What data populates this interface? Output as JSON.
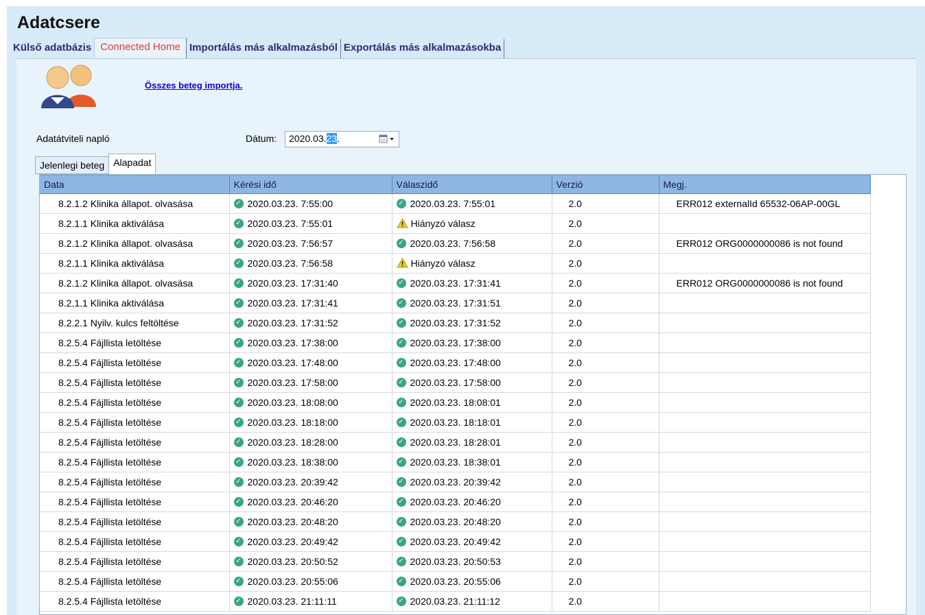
{
  "app": {
    "title": "Adatcsere"
  },
  "main_tabs": [
    {
      "label": "Külső adatbázis",
      "active": false
    },
    {
      "label": "Connected Home",
      "active": true
    },
    {
      "label": "Importálás más alkalmazásból",
      "active": false
    },
    {
      "label": "Exportálás más alkalmazásokba",
      "active": false
    }
  ],
  "import_link": "Összes beteg importja.",
  "log_label": "Adatátviteli napló",
  "date": {
    "label": "Dátum:",
    "value_prefix": "2020.03.",
    "value_selected": "23",
    "value_suffix": "."
  },
  "sub_tabs": [
    {
      "label": "Jelenlegi beteg",
      "active": false
    },
    {
      "label": "Alapadat",
      "active": true
    }
  ],
  "colors": {
    "ok": "#3aa582",
    "warn": "#f2d21b",
    "header": "#8db6e4",
    "active_tab": "#e23838",
    "link": "#0b00d6"
  },
  "table": {
    "columns": [
      "Data",
      "Kérési idő",
      "Válaszidő",
      "Verzió",
      "Megj."
    ],
    "rows": [
      {
        "data": "8.2.1.2 Klinika állapot. olvasása",
        "req": "2020.03.23. 7:55:00",
        "resp": "2020.03.23. 7:55:01",
        "resp_status": "ok",
        "ver": "2.0",
        "note": "ERR012 externalId 65532-06AP-00GL"
      },
      {
        "data": "8.2.1.1 Klinika aktiválása",
        "req": "2020.03.23. 7:55:01",
        "resp": "Hiányzó válasz",
        "resp_status": "warn",
        "ver": "2.0",
        "note": ""
      },
      {
        "data": "8.2.1.2 Klinika állapot. olvasása",
        "req": "2020.03.23. 7:56:57",
        "resp": "2020.03.23. 7:56:58",
        "resp_status": "ok",
        "ver": "2.0",
        "note": "ERR012 ORG0000000086 is not found"
      },
      {
        "data": "8.2.1.1 Klinika aktiválása",
        "req": "2020.03.23. 7:56:58",
        "resp": "Hiányzó válasz",
        "resp_status": "warn",
        "ver": "2.0",
        "note": ""
      },
      {
        "data": "8.2.1.2 Klinika állapot. olvasása",
        "req": "2020.03.23. 17:31:40",
        "resp": "2020.03.23. 17:31:41",
        "resp_status": "ok",
        "ver": "2.0",
        "note": "ERR012 ORG0000000086 is not found"
      },
      {
        "data": "8.2.1.1 Klinika aktiválása",
        "req": "2020.03.23. 17:31:41",
        "resp": "2020.03.23. 17:31:51",
        "resp_status": "ok",
        "ver": "2.0",
        "note": ""
      },
      {
        "data": "8.2.2.1 Nyilv. kulcs feltöltése",
        "req": "2020.03.23. 17:31:52",
        "resp": "2020.03.23. 17:31:52",
        "resp_status": "ok",
        "ver": "2.0",
        "note": ""
      },
      {
        "data": "8.2.5.4 Fájllista letöltése",
        "req": "2020.03.23. 17:38:00",
        "resp": "2020.03.23. 17:38:00",
        "resp_status": "ok",
        "ver": "2.0",
        "note": ""
      },
      {
        "data": "8.2.5.4 Fájllista letöltése",
        "req": "2020.03.23. 17:48:00",
        "resp": "2020.03.23. 17:48:00",
        "resp_status": "ok",
        "ver": "2.0",
        "note": ""
      },
      {
        "data": "8.2.5.4 Fájllista letöltése",
        "req": "2020.03.23. 17:58:00",
        "resp": "2020.03.23. 17:58:00",
        "resp_status": "ok",
        "ver": "2.0",
        "note": ""
      },
      {
        "data": "8.2.5.4 Fájllista letöltése",
        "req": "2020.03.23. 18:08:00",
        "resp": "2020.03.23. 18:08:01",
        "resp_status": "ok",
        "ver": "2.0",
        "note": ""
      },
      {
        "data": "8.2.5.4 Fájllista letöltése",
        "req": "2020.03.23. 18:18:00",
        "resp": "2020.03.23. 18:18:01",
        "resp_status": "ok",
        "ver": "2.0",
        "note": ""
      },
      {
        "data": "8.2.5.4 Fájllista letöltése",
        "req": "2020.03.23. 18:28:00",
        "resp": "2020.03.23. 18:28:01",
        "resp_status": "ok",
        "ver": "2.0",
        "note": ""
      },
      {
        "data": "8.2.5.4 Fájllista letöltése",
        "req": "2020.03.23. 18:38:00",
        "resp": "2020.03.23. 18:38:01",
        "resp_status": "ok",
        "ver": "2.0",
        "note": ""
      },
      {
        "data": "8.2.5.4 Fájllista letöltése",
        "req": "2020.03.23. 20:39:42",
        "resp": "2020.03.23. 20:39:42",
        "resp_status": "ok",
        "ver": "2.0",
        "note": ""
      },
      {
        "data": "8.2.5.4 Fájllista letöltése",
        "req": "2020.03.23. 20:46:20",
        "resp": "2020.03.23. 20:46:20",
        "resp_status": "ok",
        "ver": "2.0",
        "note": ""
      },
      {
        "data": "8.2.5.4 Fájllista letöltése",
        "req": "2020.03.23. 20:48:20",
        "resp": "2020.03.23. 20:48:20",
        "resp_status": "ok",
        "ver": "2.0",
        "note": ""
      },
      {
        "data": "8.2.5.4 Fájllista letöltése",
        "req": "2020.03.23. 20:49:42",
        "resp": "2020.03.23. 20:49:42",
        "resp_status": "ok",
        "ver": "2.0",
        "note": ""
      },
      {
        "data": "8.2.5.4 Fájllista letöltése",
        "req": "2020.03.23. 20:50:52",
        "resp": "2020.03.23. 20:50:53",
        "resp_status": "ok",
        "ver": "2.0",
        "note": ""
      },
      {
        "data": "8.2.5.4 Fájllista letöltése",
        "req": "2020.03.23. 20:55:06",
        "resp": "2020.03.23. 20:55:06",
        "resp_status": "ok",
        "ver": "2.0",
        "note": ""
      },
      {
        "data": "8.2.5.4 Fájllista letöltése",
        "req": "2020.03.23. 21:11:11",
        "resp": "2020.03.23. 21:11:12",
        "resp_status": "ok",
        "ver": "2.0",
        "note": ""
      }
    ]
  }
}
